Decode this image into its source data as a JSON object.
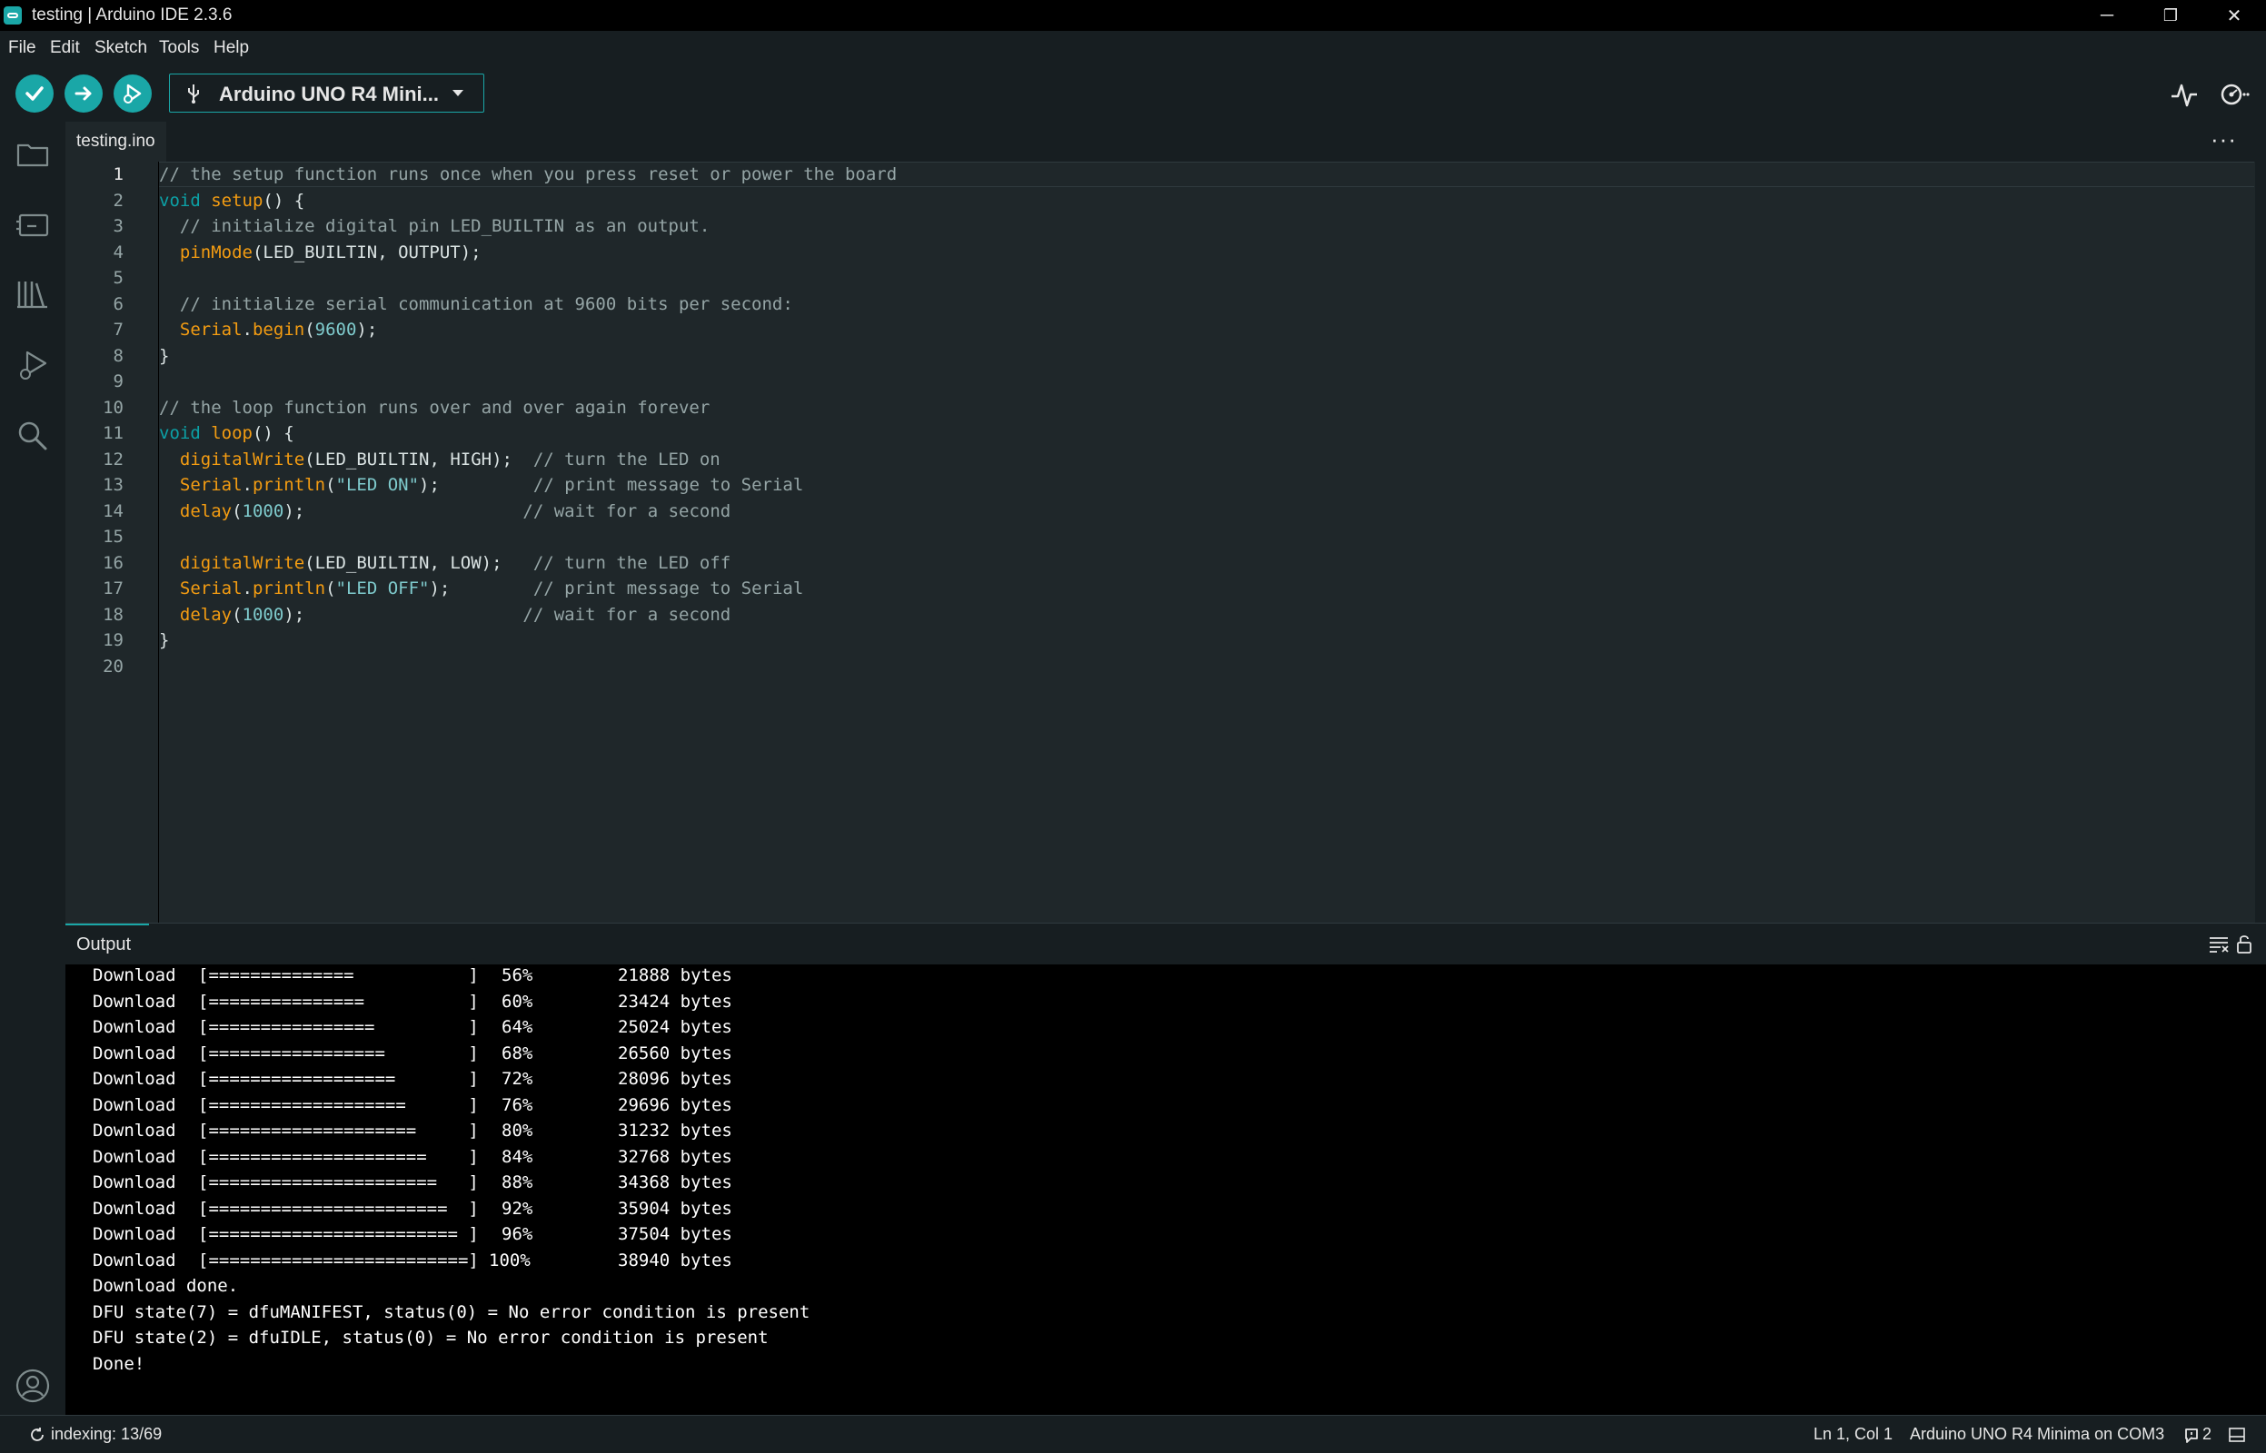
{
  "window": {
    "title": "testing | Arduino IDE 2.3.6",
    "controls": {
      "minimize": "─",
      "restore": "❐",
      "close": "✕"
    }
  },
  "menu": [
    "File",
    "Edit",
    "Sketch",
    "Tools",
    "Help"
  ],
  "toolbar": {
    "board": "Arduino UNO R4 Mini...",
    "accent": "#1aa7a7"
  },
  "editor": {
    "tab": "testing.ino",
    "more": "···",
    "line_numbers": [
      "1",
      "2",
      "3",
      "4",
      "5",
      "6",
      "7",
      "8",
      "9",
      "10",
      "11",
      "12",
      "13",
      "14",
      "15",
      "16",
      "17",
      "18",
      "19",
      "20"
    ],
    "code": {
      "l1": "// the setup function runs once when you press reset or power the board",
      "l2_kw": "void",
      "l2_fn": "setup",
      "l2_rest": "() {",
      "l3": "  // initialize digital pin LED_BUILTIN as an output.",
      "l4_fn": "pinMode",
      "l4_rest": "(LED_BUILTIN, OUTPUT);",
      "l6": "  // initialize serial communication at 9600 bits per second:",
      "l7_fn": "Serial",
      "l7_dot": ".",
      "l7_fn2": "begin",
      "l7_p1": "(",
      "l7_num": "9600",
      "l7_p2": ");",
      "l8": "}",
      "l10": "// the loop function runs over and over again forever",
      "l11_kw": "void",
      "l11_fn": "loop",
      "l11_rest": "() {",
      "l12_fn": "digitalWrite",
      "l12_rest": "(LED_BUILTIN, HIGH);  ",
      "l12_cm": "// turn the LED on",
      "l13_fn": "Serial",
      "l13_dot": ".",
      "l13_fn2": "println",
      "l13_p1": "(",
      "l13_str": "\"LED ON\"",
      "l13_p2": ");         ",
      "l13_cm": "// print message to Serial",
      "l14_fn": "delay",
      "l14_p1": "(",
      "l14_num": "1000",
      "l14_p2": ");                     ",
      "l14_cm": "// wait for a second",
      "l16_fn": "digitalWrite",
      "l16_rest": "(LED_BUILTIN, LOW);   ",
      "l16_cm": "// turn the LED off",
      "l17_fn": "Serial",
      "l17_dot": ".",
      "l17_fn2": "println",
      "l17_p1": "(",
      "l17_str": "\"LED OFF\"",
      "l17_p2": ");        ",
      "l17_cm": "// print message to Serial",
      "l18_fn": "delay",
      "l18_p1": "(",
      "l18_num": "1000",
      "l18_p2": ");                     ",
      "l18_cm": "// wait for a second",
      "l19": "}"
    }
  },
  "output": {
    "title": "Output",
    "downloads": [
      {
        "label": "Download",
        "bar": "[==============           ]",
        "pct": "56%",
        "bytes": "21888 bytes"
      },
      {
        "label": "Download",
        "bar": "[===============          ]",
        "pct": "60%",
        "bytes": "23424 bytes"
      },
      {
        "label": "Download",
        "bar": "[================         ]",
        "pct": "64%",
        "bytes": "25024 bytes"
      },
      {
        "label": "Download",
        "bar": "[=================        ]",
        "pct": "68%",
        "bytes": "26560 bytes"
      },
      {
        "label": "Download",
        "bar": "[==================       ]",
        "pct": "72%",
        "bytes": "28096 bytes"
      },
      {
        "label": "Download",
        "bar": "[===================      ]",
        "pct": "76%",
        "bytes": "29696 bytes"
      },
      {
        "label": "Download",
        "bar": "[====================     ]",
        "pct": "80%",
        "bytes": "31232 bytes"
      },
      {
        "label": "Download",
        "bar": "[=====================    ]",
        "pct": "84%",
        "bytes": "32768 bytes"
      },
      {
        "label": "Download",
        "bar": "[======================   ]",
        "pct": "88%",
        "bytes": "34368 bytes"
      },
      {
        "label": "Download",
        "bar": "[=======================  ]",
        "pct": "92%",
        "bytes": "35904 bytes"
      },
      {
        "label": "Download",
        "bar": "[======================== ]",
        "pct": "96%",
        "bytes": "37504 bytes"
      },
      {
        "label": "Download",
        "bar": "[=========================]",
        "pct": "100%",
        "bytes": "38940 bytes"
      }
    ],
    "tail": [
      "Download done.",
      "DFU state(7) = dfuMANIFEST, status(0) = No error condition is present",
      "DFU state(2) = dfuIDLE, status(0) = No error condition is present",
      "Done!"
    ]
  },
  "status": {
    "indexing": "indexing: 13/69",
    "position": "Ln 1, Col 1",
    "board_port": "Arduino UNO R4 Minima on COM3",
    "notifications": "2"
  }
}
